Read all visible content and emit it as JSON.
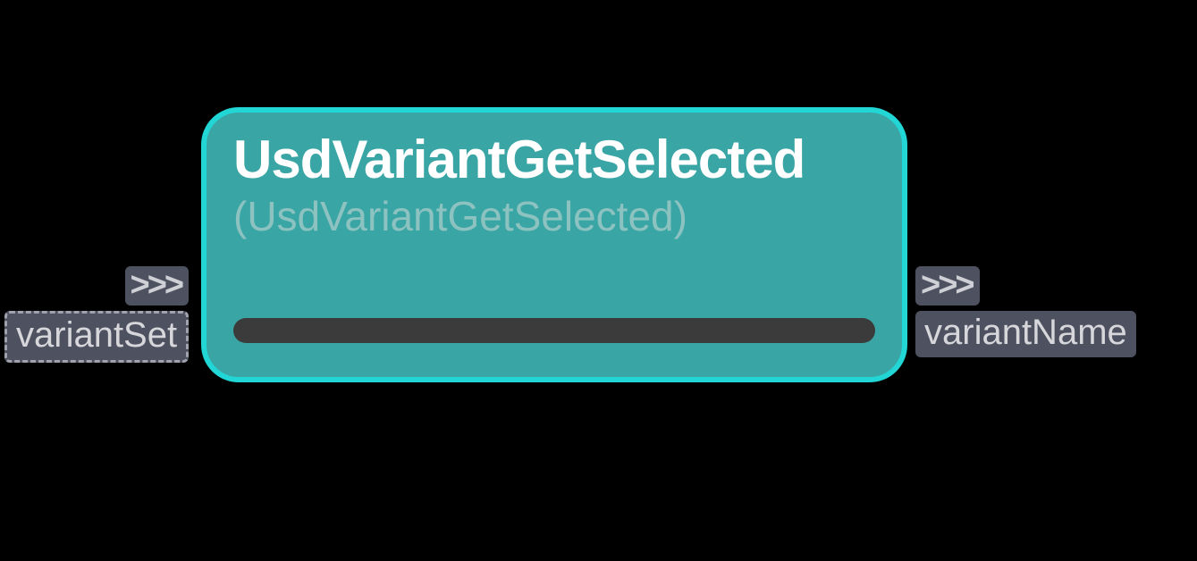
{
  "node": {
    "title": "UsdVariantGetSelected",
    "subtitle": "(UsdVariantGetSelected)"
  },
  "ports": {
    "input": {
      "arrows": ">>>",
      "label": "variantSet"
    },
    "output": {
      "arrows": ">>>",
      "label": "variantName"
    }
  }
}
